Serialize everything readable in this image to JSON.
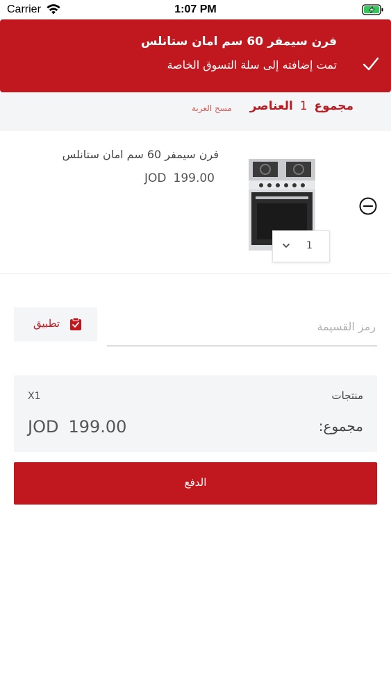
{
  "status_bar": {
    "carrier": "Carrier",
    "time": "1:07 PM",
    "wifi_icon": "wifi-icon",
    "battery_icon": "battery-charging-icon"
  },
  "banner": {
    "title": "فرن سيمفر 60 سم امان ستانلس",
    "subtitle": "تمت إضافته إلى سلة التسوق الخاصة",
    "icon": "checkmark-icon",
    "background_color": "#c1171e"
  },
  "cart_header": {
    "total_label": "مجموع",
    "item_count": "1",
    "items_label": "العناصر",
    "clear_cart": "مسح العربة"
  },
  "cart_item": {
    "name": "فرن سيمفر 60 سم امان ستانلس",
    "price": "199.00",
    "currency": "JOD",
    "quantity": "1",
    "image_icon": "stove-product-image",
    "remove_icon": "minus-circle-icon",
    "qty_icon": "chevron-down-icon"
  },
  "coupon": {
    "placeholder": "رمز القسيمة",
    "apply_label": "تطبيق",
    "apply_icon": "clipboard-check-icon"
  },
  "summary": {
    "products_label": "منتجات",
    "products_qty": "X1",
    "total_label": "مجموع:",
    "total_value": "199.00",
    "currency": "JOD"
  },
  "checkout": {
    "pay_label": "الدفع"
  },
  "colors": {
    "accent": "#c1171e",
    "panel": "#f4f5f7"
  }
}
